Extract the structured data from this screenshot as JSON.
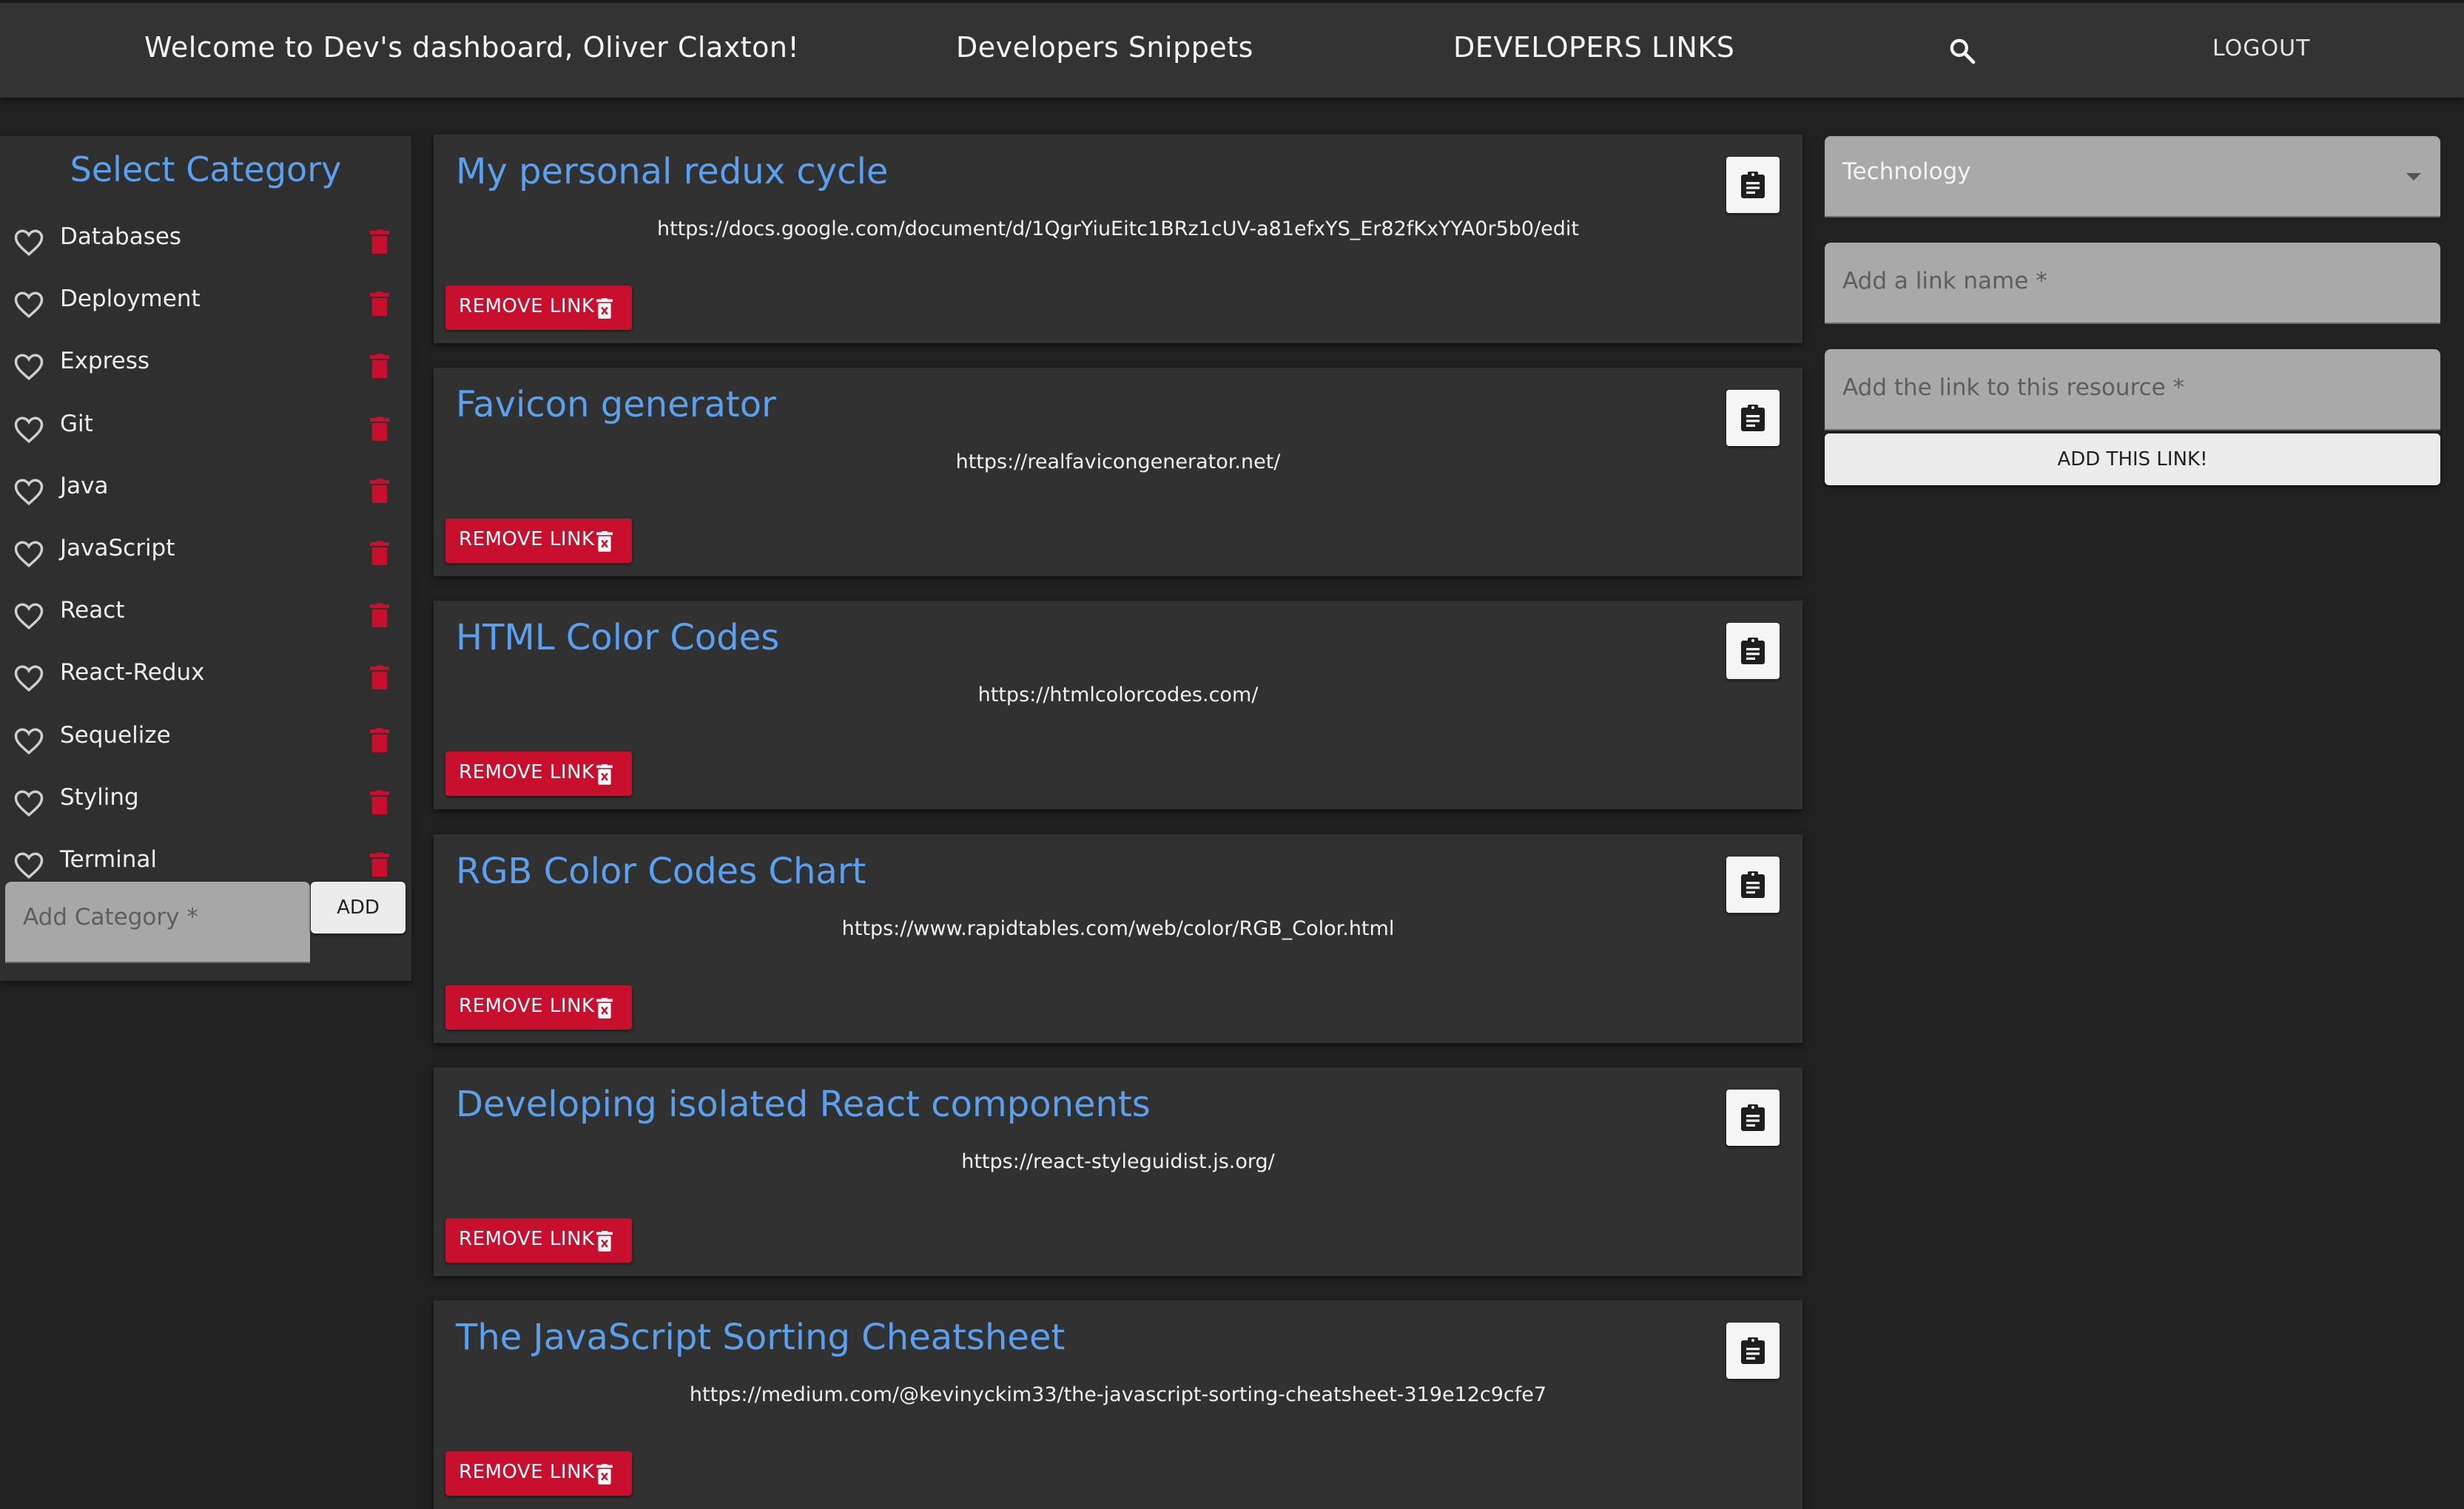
{
  "header": {
    "welcome": "Welcome to Dev's dashboard, Oliver Claxton!",
    "snippets": "Developers Snippets",
    "links": "DEVELOPERS LINKS",
    "search_icon": "search-icon",
    "logout": "LOGOUT"
  },
  "sidebar": {
    "title": "Select Category",
    "categories": [
      "Databases",
      "Deployment",
      "Express",
      "Git",
      "Java",
      "JavaScript",
      "React",
      "React-Redux",
      "Sequelize",
      "Styling",
      "Terminal"
    ],
    "add_placeholder": "Add Category *",
    "add_button": "ADD"
  },
  "links": [
    {
      "title": "My personal redux cycle",
      "url": "https://docs.google.com/document/d/1QgrYiuEitc1BRz1cUV-a81efxYS_Er82fKxYYA0r5b0/edit",
      "remove_label": "REMOVE LINK"
    },
    {
      "title": "Favicon generator",
      "url": "https://realfavicongenerator.net/",
      "remove_label": "REMOVE LINK"
    },
    {
      "title": "HTML Color Codes",
      "url": "https://htmlcolorcodes.com/",
      "remove_label": "REMOVE LINK"
    },
    {
      "title": "RGB Color Codes Chart",
      "url": "https://www.rapidtables.com/web/color/RGB_Color.html",
      "remove_label": "REMOVE LINK"
    },
    {
      "title": "Developing isolated React components",
      "url": "https://react-styleguidist.js.org/",
      "remove_label": "REMOVE LINK"
    },
    {
      "title": "The JavaScript Sorting Cheatsheet",
      "url": "https://medium.com/@kevinyckim33/the-javascript-sorting-cheatsheet-319e12c9cfe7",
      "remove_label": "REMOVE LINK"
    }
  ],
  "form": {
    "category_selected": "Technology",
    "link_name_placeholder": "Add a link name *",
    "link_url_placeholder": "Add the link to this resource *",
    "submit": "ADD THIS LINK!"
  },
  "colors": {
    "accent": "#5aa0ef",
    "remove": "#c8102e",
    "background": "#212121",
    "card": "#313131"
  }
}
